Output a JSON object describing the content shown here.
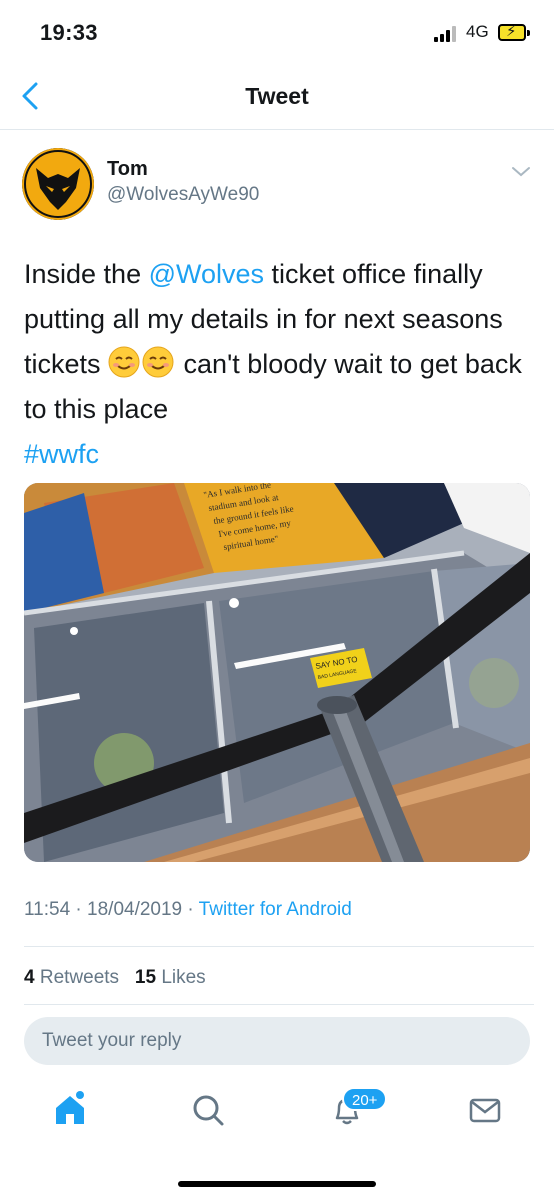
{
  "status_bar": {
    "time": "19:33",
    "network": "4G"
  },
  "header": {
    "title": "Tweet"
  },
  "tweet": {
    "author_name": "Tom",
    "author_handle": "@WolvesAyWe90",
    "text_parts": {
      "t1": "Inside the ",
      "mention": "@Wolves",
      "t2": " ticket office finally putting all my details in for next seasons tickets ",
      "t3": " can't bloody wait to get back to this place",
      "hashtag": "#wwfc"
    },
    "photo": {
      "sign_text": [
        "\"As I walk into the",
        "stadium and look at",
        "the ground it feels like",
        "I've come home, my",
        "spiritual home\""
      ],
      "sticker_text": [
        "SAY NO TO",
        "BAD LANGUAGE"
      ]
    },
    "time": "11:54",
    "date": "18/04/2019",
    "source": "Twitter for Android",
    "retweets": "4",
    "retweets_label": "Retweets",
    "likes": "15",
    "likes_label": "Likes"
  },
  "reply": {
    "placeholder": "Tweet your reply"
  },
  "tabbar": {
    "items": [
      "home-icon",
      "search-icon",
      "notifications-icon",
      "messages-icon"
    ],
    "notifications_badge": "20+"
  },
  "colors": {
    "accent": "#1da1f2",
    "secondary_text": "#657786",
    "divider": "#e1e8ed"
  }
}
